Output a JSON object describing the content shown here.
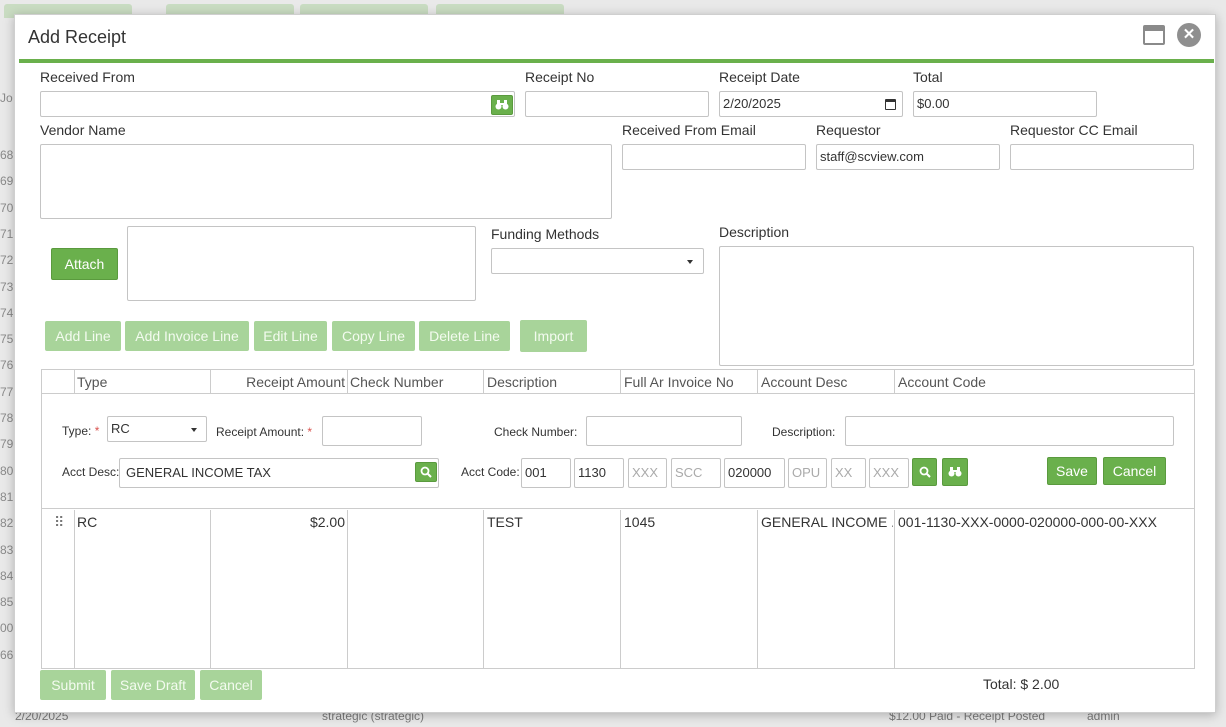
{
  "background": {
    "row_numbers": [
      "68",
      "69",
      "70",
      "71",
      "72",
      "73",
      "74",
      "75",
      "76",
      "77",
      "78",
      "79",
      "80",
      "81",
      "82",
      "83",
      "84",
      "85",
      "00",
      "66"
    ],
    "header_fragment": "Jo",
    "bottom_row": {
      "date": "2/20/2025",
      "fund": "strategic (strategic)",
      "amount_status": "$12.00 Paid - Receipt Posted",
      "user": "admin"
    }
  },
  "dialog": {
    "title": "Add Receipt",
    "maximize_icon": "window-maximize-icon",
    "close_icon": "close-icon",
    "accent_color": "#6ab04c"
  },
  "form": {
    "received_from": {
      "label": "Received From",
      "value": "",
      "lookup_icon": "binoculars-icon"
    },
    "receipt_no": {
      "label": "Receipt No",
      "value": ""
    },
    "receipt_date": {
      "label": "Receipt Date",
      "value": "2/20/2025",
      "icon": "calendar-icon"
    },
    "total": {
      "label": "Total",
      "value": "$0.00"
    },
    "vendor_name": {
      "label": "Vendor Name",
      "value": ""
    },
    "received_from_email": {
      "label": "Received From Email",
      "value": ""
    },
    "requestor": {
      "label": "Requestor",
      "value": "staff@scview.com"
    },
    "requestor_cc_email": {
      "label": "Requestor CC Email",
      "value": ""
    },
    "attach_label": "Attach",
    "funding_methods": {
      "label": "Funding Methods",
      "value": ""
    },
    "description": {
      "label": "Description",
      "value": ""
    }
  },
  "toolbar": {
    "add_line": "Add Line",
    "add_invoice_line": "Add Invoice Line",
    "edit_line": "Edit Line",
    "copy_line": "Copy Line",
    "delete_line": "Delete Line",
    "import": "Import"
  },
  "grid": {
    "columns": [
      "Type",
      "Receipt Amount",
      "Check Number",
      "Description",
      "Full Ar Invoice No",
      "Account Desc",
      "Account Code"
    ],
    "editor": {
      "type_label": "Type:",
      "type_value": "RC",
      "receipt_amount_label": "Receipt Amount:",
      "receipt_amount_value": "",
      "check_number_label": "Check Number:",
      "check_number_value": "",
      "description_label": "Description:",
      "description_value": "",
      "acct_desc_label": "Acct Desc:",
      "acct_desc_value": "GENERAL INCOME TAX",
      "acct_code_label": "Acct Code:",
      "acct_code_parts": [
        {
          "value": "001",
          "placeholder": ""
        },
        {
          "value": "1130",
          "placeholder": ""
        },
        {
          "value": "",
          "placeholder": "XXX"
        },
        {
          "value": "",
          "placeholder": "SCC"
        },
        {
          "value": "020000",
          "placeholder": ""
        },
        {
          "value": "",
          "placeholder": "OPU"
        },
        {
          "value": "",
          "placeholder": "XX"
        },
        {
          "value": "",
          "placeholder": "XXX"
        }
      ],
      "save_label": "Save",
      "cancel_label": "Cancel"
    },
    "rows": [
      {
        "type": "RC",
        "receipt_amount": "$2.00",
        "check_number": "",
        "description": "TEST",
        "full_ar_invoice_no": "1045",
        "account_desc": "GENERAL INCOME ...",
        "account_code": "001-1130-XXX-0000-020000-000-00-XXX"
      }
    ]
  },
  "footer": {
    "submit": "Submit",
    "save_draft": "Save Draft",
    "cancel": "Cancel",
    "total_text": "Total: $ 2.00"
  }
}
